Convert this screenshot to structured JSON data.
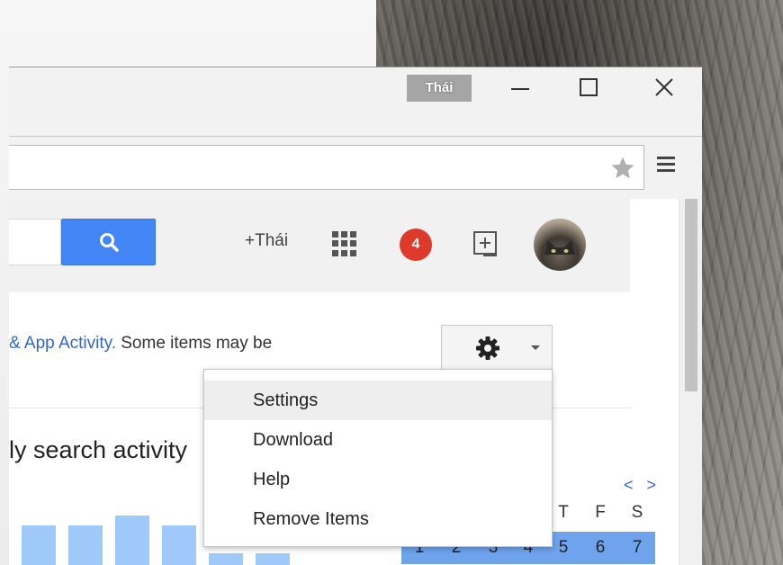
{
  "window": {
    "profile_name": "Thái"
  },
  "page": {
    "header": {
      "profile_link": "+Thái",
      "notification_count": "4"
    },
    "activity_text": {
      "link": "& App Activity.",
      "rest": " Some items may be"
    },
    "section_title": "ly search activity",
    "bars": [
      {
        "value": 57
      },
      {
        "value": 57
      },
      {
        "value": 68
      },
      {
        "value": 57
      },
      {
        "value": 26
      },
      {
        "value": 26
      }
    ],
    "calendar": {
      "nav": "< >",
      "days": [
        "T",
        "F",
        "S"
      ],
      "dates": [
        "1",
        "2",
        "3",
        "4",
        "5",
        "6",
        "7"
      ]
    }
  },
  "menu": {
    "items": [
      {
        "label": "Settings"
      },
      {
        "label": "Download"
      },
      {
        "label": "Help"
      },
      {
        "label": "Remove Items"
      }
    ]
  },
  "colors": {
    "accent": "#4285f4",
    "badge": "#dd3a2a",
    "link": "#3366cc",
    "bars": "#9fc9f8",
    "calendar_row": "#6fa3ec"
  }
}
